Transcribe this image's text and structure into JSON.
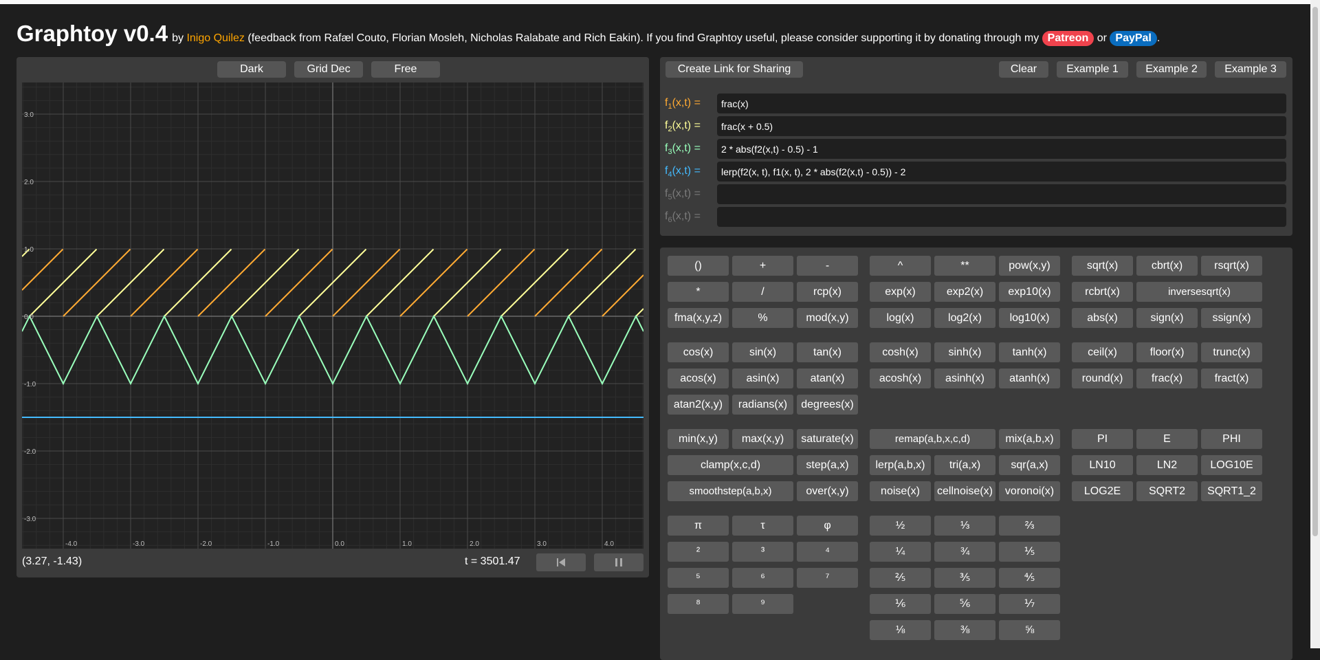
{
  "header": {
    "title": "Graphtoy v0.4",
    "by": "by",
    "author": "Inigo Quilez",
    "credits": "(feedback from Rafæl Couto, Florian Mosleh, Nicholas Ralabate and Rich Eakin). If you find Graphtoy useful, please consider supporting it by donating through my",
    "patreon": "Patreon",
    "or": "or",
    "paypal": "PayPal",
    "period": "."
  },
  "graph": {
    "buttons": [
      "Dark",
      "Grid Dec",
      "Free"
    ],
    "coords": "(3.27, -1.43)",
    "time": "t = 3501.47",
    "restart_icon": "skip-back-icon",
    "pause_icon": "pause-icon",
    "y_ticks": [
      "3.0",
      "2.0",
      "1.0",
      "0.0",
      "-1.0",
      "-2.0",
      "-3.0"
    ],
    "x_ticks": [
      "-4.0",
      "-3.0",
      "-2.0",
      "-1.0",
      "0.0",
      "1.0",
      "2.0",
      "3.0",
      "4.0"
    ]
  },
  "editor": {
    "share": "Create Link for Sharing",
    "clear": "Clear",
    "examples": [
      "Example 1",
      "Example 2",
      "Example 3"
    ],
    "functions": [
      {
        "name": "f",
        "sub": "1",
        "args": "(x,t) =",
        "expr": "frac(x)",
        "color": "#ffaa33"
      },
      {
        "name": "f",
        "sub": "2",
        "args": "(x,t) =",
        "expr": "frac(x + 0.5)",
        "color": "#ffff99"
      },
      {
        "name": "f",
        "sub": "3",
        "args": "(x,t) =",
        "expr": "2 * abs(f2(x,t) - 0.5) - 1",
        "color": "#99ffbb"
      },
      {
        "name": "f",
        "sub": "4",
        "args": "(x,t) =",
        "expr": "lerp(f2(x, t), f1(x, t), 2 * abs(f2(x,t) - 0.5)) - 2",
        "color": "#44bbff"
      },
      {
        "name": "f",
        "sub": "5",
        "args": "(x,t) =",
        "expr": "",
        "color": "#7a7a7a"
      },
      {
        "name": "f",
        "sub": "6",
        "args": "(x,t) =",
        "expr": "",
        "color": "#7a7a7a"
      }
    ]
  },
  "keyboard": {
    "group1": [
      [
        "()",
        "+",
        "-"
      ],
      [
        "*",
        "/",
        "rcp(x)"
      ],
      [
        "fma(x,y,z)",
        "%",
        "mod(x,y)"
      ]
    ],
    "group2": [
      [
        "^",
        "**",
        "pow(x,y)"
      ],
      [
        "exp(x)",
        "exp2(x)",
        "exp10(x)"
      ],
      [
        "log(x)",
        "log2(x)",
        "log10(x)"
      ]
    ],
    "group3": [
      [
        "sqrt(x)",
        "cbrt(x)",
        "rsqrt(x)"
      ],
      [
        "rcbrt(x)",
        "inversesqrt(x)"
      ],
      [
        "abs(x)",
        "sign(x)",
        "ssign(x)"
      ]
    ],
    "group4": [
      [
        "cos(x)",
        "sin(x)",
        "tan(x)"
      ],
      [
        "acos(x)",
        "asin(x)",
        "atan(x)"
      ],
      [
        "atan2(x,y)",
        "radians(x)",
        "degrees(x)"
      ]
    ],
    "group5": [
      [
        "cosh(x)",
        "sinh(x)",
        "tanh(x)"
      ],
      [
        "acosh(x)",
        "asinh(x)",
        "atanh(x)"
      ]
    ],
    "group6": [
      [
        "ceil(x)",
        "floor(x)",
        "trunc(x)"
      ],
      [
        "round(x)",
        "frac(x)",
        "fract(x)"
      ]
    ],
    "group7": [
      [
        "min(x,y)",
        "max(x,y)",
        "saturate(x)"
      ],
      [
        "clamp(x,c,d)",
        "step(a,x)"
      ],
      [
        "smoothstep(a,b,x)",
        "over(x,y)"
      ]
    ],
    "group8": [
      [
        "remap(a,b,x,c,d)",
        "mix(a,b,x)"
      ],
      [
        "lerp(a,b,x)",
        "tri(a,x)",
        "sqr(a,x)"
      ],
      [
        "noise(x)",
        "cellnoise(x)",
        "voronoi(x)"
      ]
    ],
    "group9": [
      [
        "PI",
        "E",
        "PHI"
      ],
      [
        "LN10",
        "LN2",
        "LOG10E"
      ],
      [
        "LOG2E",
        "SQRT2",
        "SQRT1_2"
      ]
    ],
    "group10": [
      [
        "π",
        "τ",
        "φ"
      ],
      [
        "²",
        "³",
        "⁴"
      ],
      [
        "⁵",
        "⁶",
        "⁷"
      ],
      [
        "⁸",
        "⁹"
      ]
    ],
    "group11": [
      [
        "½",
        "⅓",
        "⅔"
      ],
      [
        "¼",
        "¾",
        "⅕"
      ],
      [
        "⅖",
        "⅗",
        "⅘"
      ],
      [
        "⅙",
        "⅚",
        "⅐"
      ],
      [
        "⅛",
        "⅜",
        "⅝"
      ]
    ]
  }
}
